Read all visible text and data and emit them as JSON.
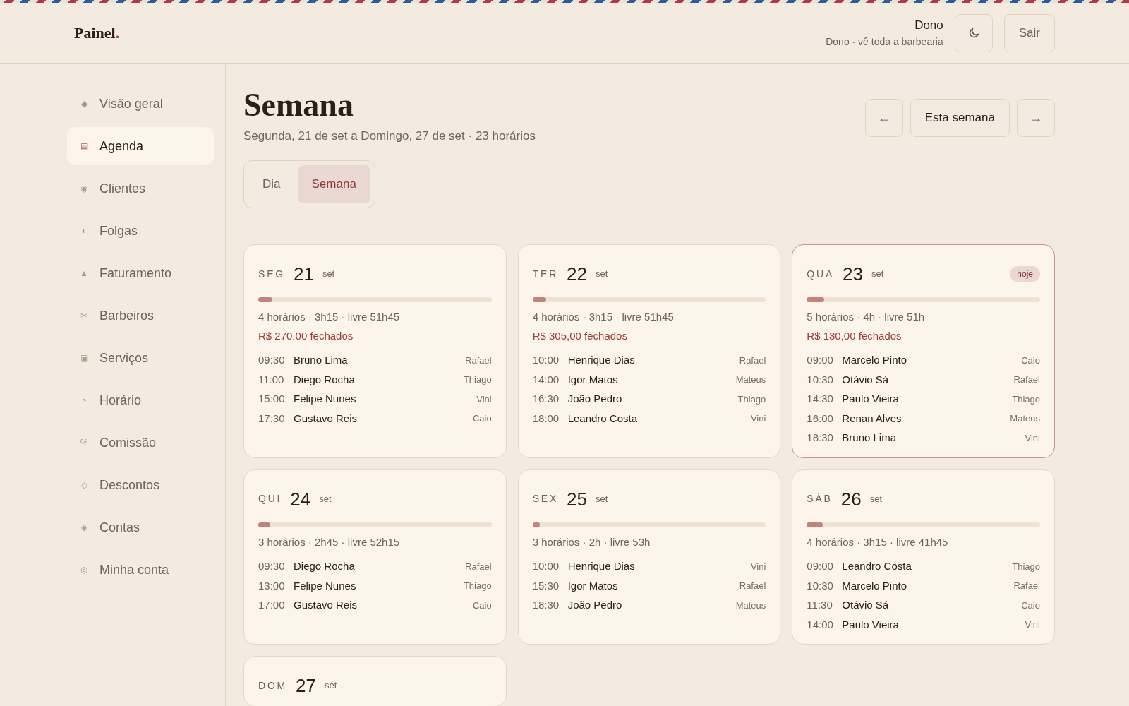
{
  "header": {
    "logo": "Painel",
    "logo_dot": ".",
    "user_name": "Dono",
    "user_role": "Dono · vê toda a barbearia",
    "logout": "Sair"
  },
  "sidebar": {
    "items": [
      {
        "glyph": "◆",
        "label": "Visão geral",
        "selected": false
      },
      {
        "glyph": "▤",
        "label": "Agenda",
        "selected": true
      },
      {
        "glyph": "◉",
        "label": "Clientes",
        "selected": false
      },
      {
        "glyph": "◐",
        "label": "Folgas",
        "selected": false
      },
      {
        "glyph": "▲",
        "label": "Faturamento",
        "selected": false
      },
      {
        "glyph": "✂",
        "label": "Barbeiros",
        "selected": false
      },
      {
        "glyph": "▣",
        "label": "Serviços",
        "selected": false
      },
      {
        "glyph": "◔",
        "label": "Horário",
        "selected": false
      },
      {
        "glyph": "%",
        "label": "Comissão",
        "selected": false
      },
      {
        "glyph": "◇",
        "label": "Descontos",
        "selected": false
      },
      {
        "glyph": "◈",
        "label": "Contas",
        "selected": false
      },
      {
        "glyph": "◎",
        "label": "Minha conta",
        "selected": false
      }
    ]
  },
  "page": {
    "title": "Semana",
    "subtitle": "Segunda, 21 de set a Domingo, 27 de set · 23 horários",
    "nav": {
      "prev": "←",
      "current": "Esta semana",
      "next": "→"
    },
    "tabs": [
      {
        "label": "Dia",
        "selected": false
      },
      {
        "label": "Semana",
        "selected": true
      }
    ]
  },
  "days": [
    {
      "weekday": "SEG",
      "day": "21",
      "month": "set",
      "today": false,
      "level": 0.06,
      "summary": "4 horários · 3h15 · livre 51h45",
      "revenue": "R$ 270,00 fechados",
      "appointments": [
        {
          "time": "09:30",
          "client": "Bruno Lima",
          "barber": "Rafael"
        },
        {
          "time": "11:00",
          "client": "Diego Rocha",
          "barber": "Thiago"
        },
        {
          "time": "15:00",
          "client": "Felipe Nunes",
          "barber": "Vini"
        },
        {
          "time": "17:30",
          "client": "Gustavo Reis",
          "barber": "Caio"
        }
      ]
    },
    {
      "weekday": "TER",
      "day": "22",
      "month": "set",
      "today": false,
      "level": 0.06,
      "summary": "4 horários · 3h15 · livre 51h45",
      "revenue": "R$ 305,00 fechados",
      "appointments": [
        {
          "time": "10:00",
          "client": "Henrique Dias",
          "barber": "Rafael"
        },
        {
          "time": "14:00",
          "client": "Igor Matos",
          "barber": "Mateus"
        },
        {
          "time": "16:30",
          "client": "João Pedro",
          "barber": "Thiago"
        },
        {
          "time": "18:00",
          "client": "Leandro Costa",
          "barber": "Vini"
        }
      ]
    },
    {
      "weekday": "QUA",
      "day": "23",
      "month": "set",
      "today": true,
      "badge": "hoje",
      "level": 0.075,
      "summary": "5 horários · 4h · livre 51h",
      "revenue": "R$ 130,00 fechados",
      "appointments": [
        {
          "time": "09:00",
          "client": "Marcelo Pinto",
          "barber": "Caio"
        },
        {
          "time": "10:30",
          "client": "Otávio Sá",
          "barber": "Rafael"
        },
        {
          "time": "14:30",
          "client": "Paulo Vieira",
          "barber": "Thiago"
        },
        {
          "time": "16:00",
          "client": "Renan Alves",
          "barber": "Mateus"
        },
        {
          "time": "18:30",
          "client": "Bruno Lima",
          "barber": "Vini"
        }
      ]
    },
    {
      "weekday": "QUI",
      "day": "24",
      "month": "set",
      "today": false,
      "level": 0.05,
      "summary": "3 horários · 2h45 · livre 52h15",
      "appointments": [
        {
          "time": "09:30",
          "client": "Diego Rocha",
          "barber": "Rafael"
        },
        {
          "time": "13:00",
          "client": "Felipe Nunes",
          "barber": "Thiago"
        },
        {
          "time": "17:00",
          "client": "Gustavo Reis",
          "barber": "Caio"
        }
      ]
    },
    {
      "weekday": "SEX",
      "day": "25",
      "month": "set",
      "today": false,
      "level": 0.03,
      "summary": "3 horários · 2h · livre 53h",
      "appointments": [
        {
          "time": "10:00",
          "client": "Henrique Dias",
          "barber": "Vini"
        },
        {
          "time": "15:30",
          "client": "Igor Matos",
          "barber": "Rafael"
        },
        {
          "time": "18:30",
          "client": "João Pedro",
          "barber": "Mateus"
        }
      ]
    },
    {
      "weekday": "SÁB",
      "day": "26",
      "month": "set",
      "today": false,
      "level": 0.07,
      "summary": "4 horários · 3h15 · livre 41h45",
      "appointments": [
        {
          "time": "09:00",
          "client": "Leandro Costa",
          "barber": "Thiago"
        },
        {
          "time": "10:30",
          "client": "Marcelo Pinto",
          "barber": "Rafael"
        },
        {
          "time": "11:30",
          "client": "Otávio Sá",
          "barber": "Caio"
        },
        {
          "time": "14:00",
          "client": "Paulo Vieira",
          "barber": "Vini"
        }
      ]
    },
    {
      "weekday": "DOM",
      "day": "27",
      "month": "set",
      "today": false
    }
  ]
}
